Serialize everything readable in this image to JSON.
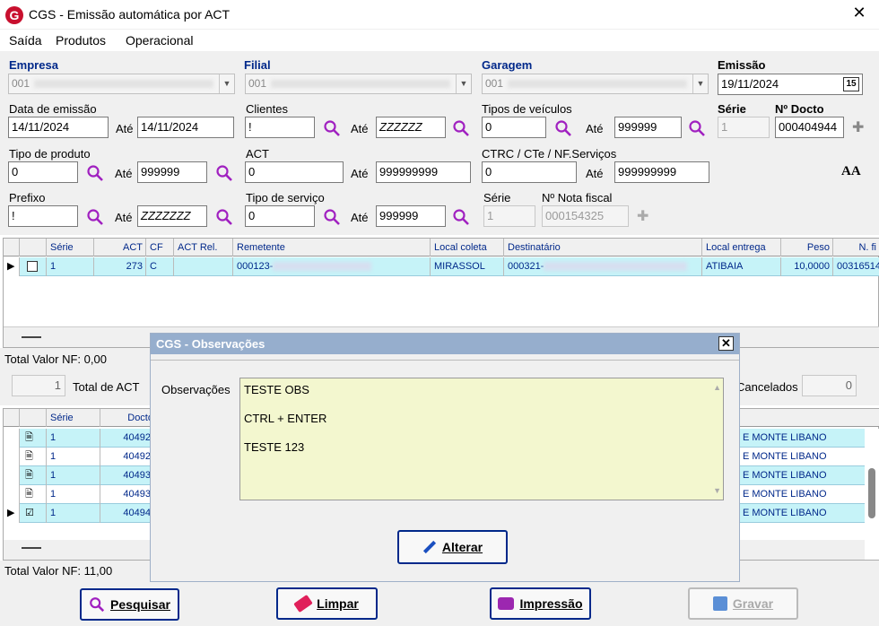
{
  "window": {
    "title": "CGS - Emissão automática por ACT"
  },
  "menu": [
    "Saída",
    "Produtos",
    "Operacional"
  ],
  "form": {
    "empresa": {
      "label": "Empresa",
      "value": "001"
    },
    "filial": {
      "label": "Filial",
      "value": "001"
    },
    "garagem": {
      "label": "Garagem",
      "value": "001"
    },
    "emissao": {
      "label": "Emissão",
      "value": "19/11/2024",
      "cal_icon": "15"
    },
    "data_emissao": {
      "label": "Data de emissão",
      "from": "14/11/2024",
      "ate": "Até",
      "to": "14/11/2024"
    },
    "clientes": {
      "label": "Clientes",
      "from": "!",
      "ate": "Até",
      "to": "ZZZZZZ"
    },
    "tipos_veiculos": {
      "label": "Tipos de veículos",
      "from": "0",
      "ate": "Até",
      "to": "999999"
    },
    "serie": {
      "label": "Série",
      "value": "1"
    },
    "n_docto": {
      "label": "Nº Docto",
      "value": "000404944"
    },
    "tipo_produto": {
      "label": "Tipo de produto",
      "from": "0",
      "ate": "Até",
      "to": "999999"
    },
    "act": {
      "label": "ACT",
      "from": "0",
      "ate": "Até",
      "to": "999999999"
    },
    "ctrc": {
      "label": "CTRC / CTe / NF.Serviços",
      "from": "0",
      "ate": "Até",
      "to": "999999999"
    },
    "font_icon": "AA",
    "prefixo": {
      "label": "Prefixo",
      "from": "!",
      "ate": "Até",
      "to": "ZZZZZZZ"
    },
    "tipo_servico": {
      "label": "Tipo de serviço",
      "from": "0",
      "ate": "Até",
      "to": "999999"
    },
    "serie2": {
      "label": "Série",
      "value": "1"
    },
    "nota_fiscal": {
      "label": "Nº Nota fiscal",
      "value": "000154325"
    }
  },
  "grid1": {
    "headers": [
      "Série",
      "ACT",
      "CF",
      "ACT Rel.",
      "Remetente",
      "Local coleta",
      "Destinatário",
      "Local entrega",
      "Peso",
      "N. fi"
    ],
    "row": {
      "serie": "1",
      "act": "273",
      "cf": "C",
      "act_rel": "",
      "remetente": "000123-",
      "local_coleta": "MIRASSOL",
      "destinatario": "000321-",
      "local_entrega": "ATIBAIA",
      "peso": "10,0000",
      "nf": "00316514"
    },
    "total": "Total Valor NF:  0,00"
  },
  "counts": {
    "total_act_value": "1",
    "total_act_label": "Total de ACT",
    "cancelados_label": "Cancelados",
    "cancelados_value": "0"
  },
  "grid2": {
    "headers": [
      "Série",
      "Docto"
    ],
    "rows": [
      {
        "serie": "1",
        "docto": "40492",
        "right": "E MONTE LIBANO"
      },
      {
        "serie": "1",
        "docto": "40492",
        "right": "E MONTE LIBANO"
      },
      {
        "serie": "1",
        "docto": "40493",
        "right": "E MONTE LIBANO"
      },
      {
        "serie": "1",
        "docto": "40493",
        "right": "E MONTE LIBANO"
      },
      {
        "serie": "1",
        "docto": "40494",
        "right": "E MONTE LIBANO"
      }
    ],
    "total": "Total Valor NF:  11,00"
  },
  "dialog": {
    "title": "CGS - Observações",
    "obs_label": "Observações",
    "lines": [
      "TESTE OBS",
      "CTRL + ENTER",
      "TESTE 123"
    ],
    "alterar": "Alterar"
  },
  "buttons": {
    "pesquisar": "Pesquisar",
    "limpar": "Limpar",
    "impressao": "Impressão",
    "gravar": "Gravar"
  }
}
